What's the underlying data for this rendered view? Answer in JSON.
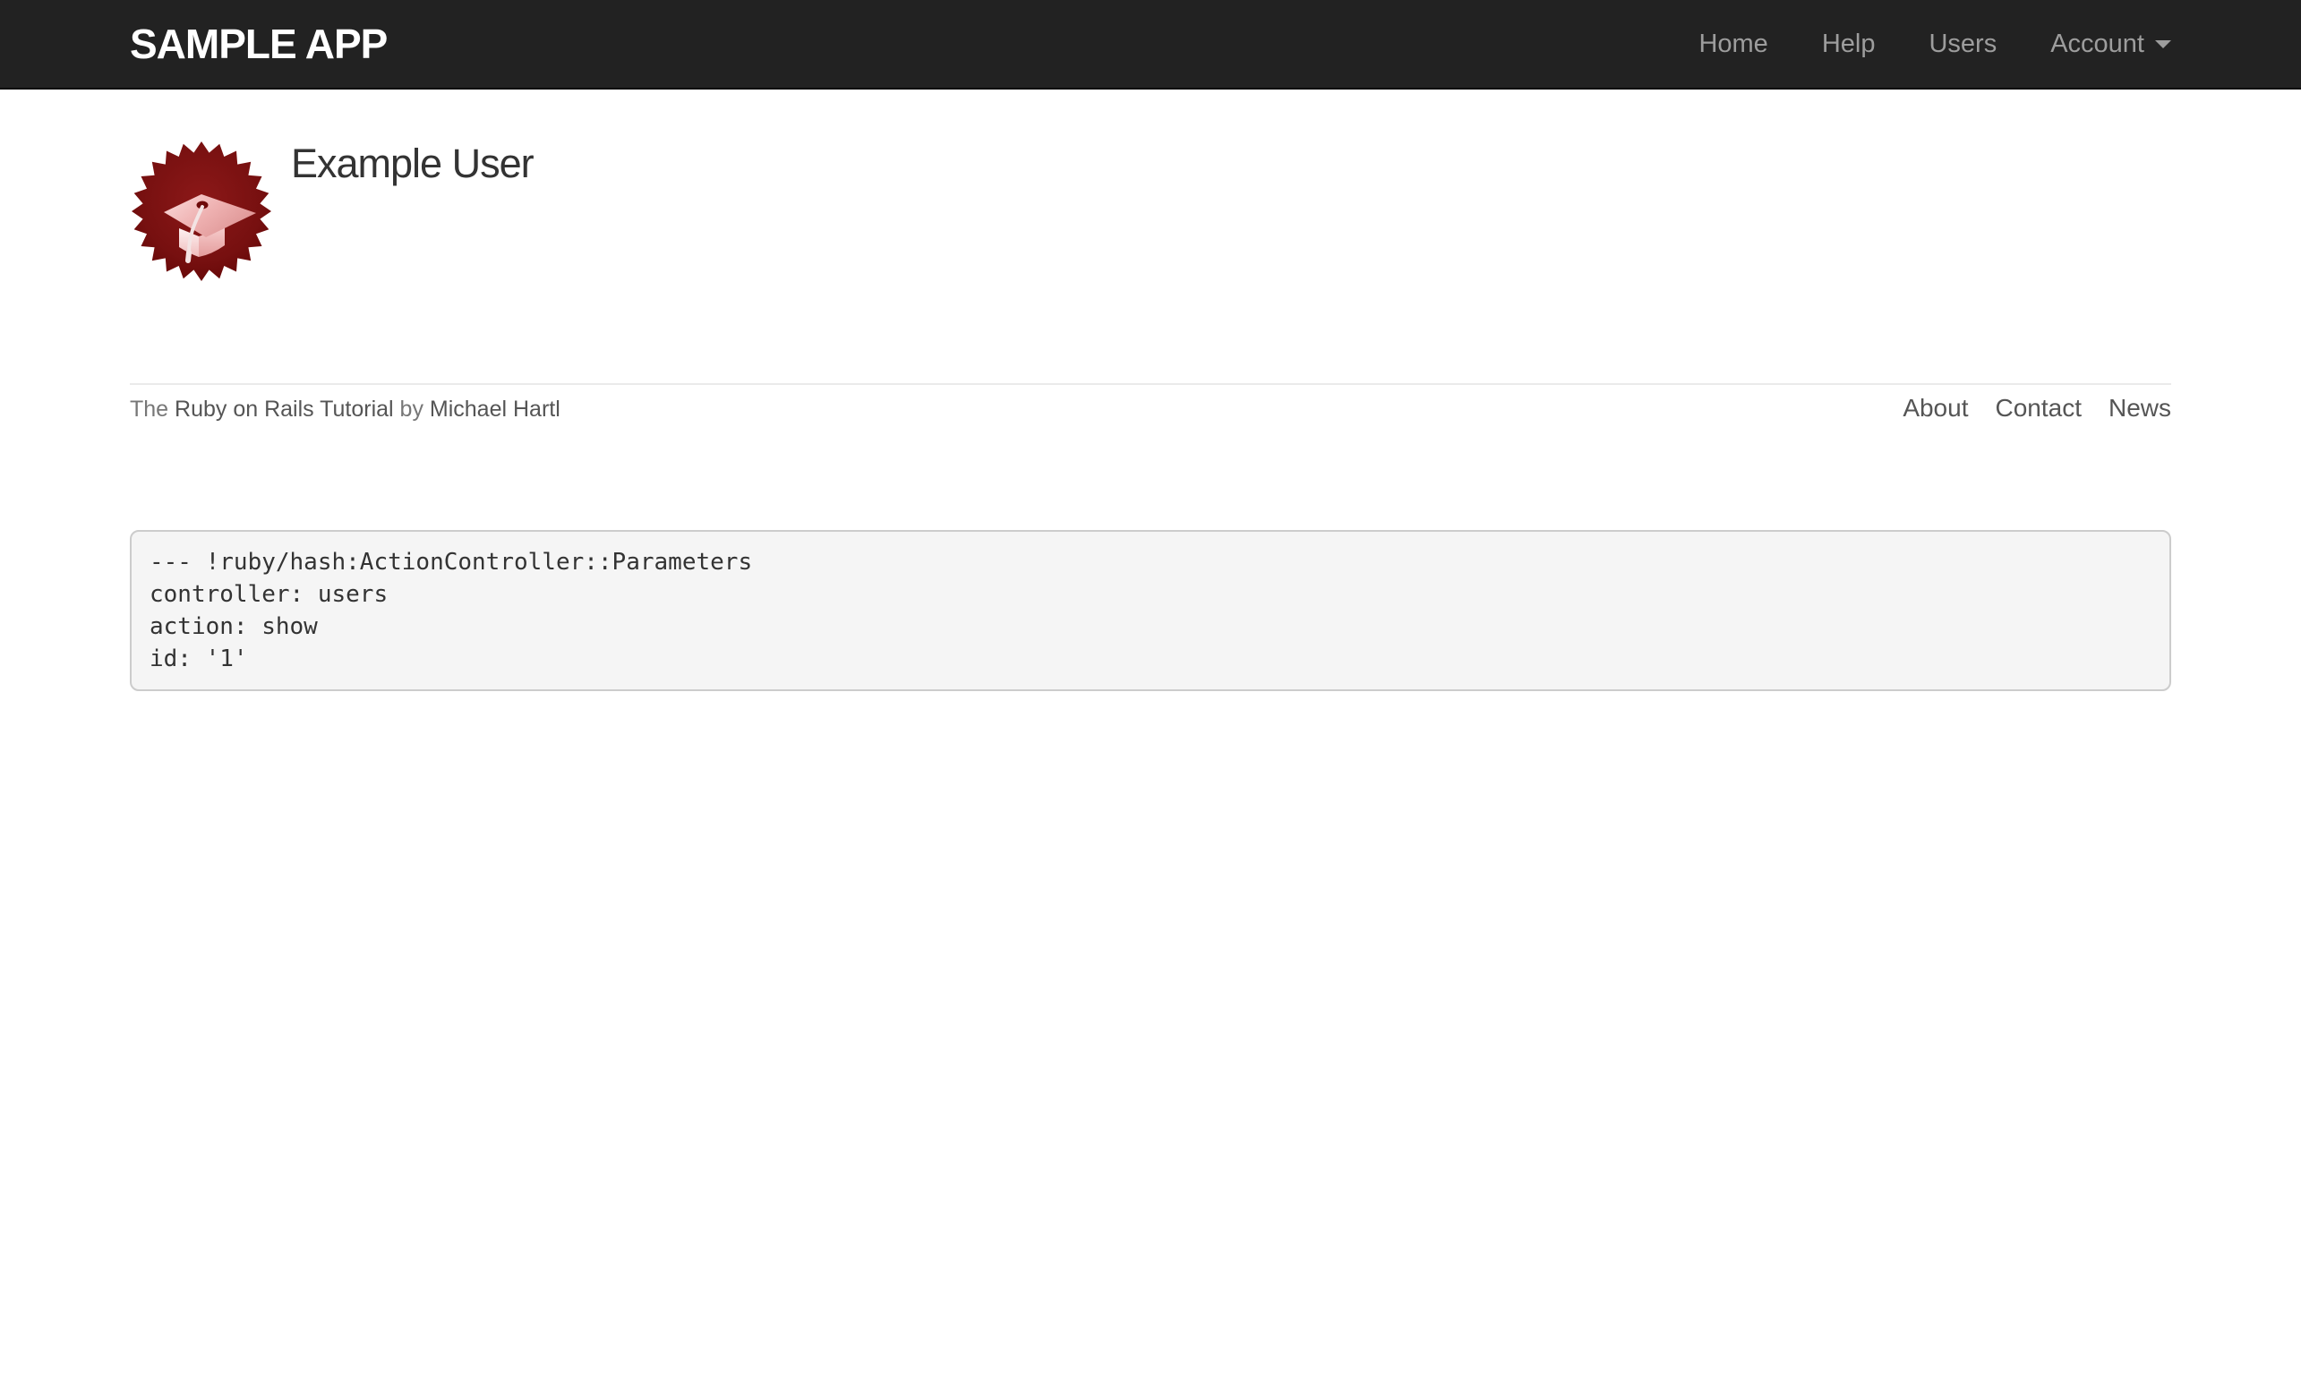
{
  "navbar": {
    "brand": "SAMPLE APP",
    "links": [
      {
        "label": "Home"
      },
      {
        "label": "Help"
      },
      {
        "label": "Users"
      },
      {
        "label": "Account",
        "has_dropdown": true
      }
    ]
  },
  "profile": {
    "user_name": "Example User",
    "avatar_description": "dark-red starburst seal with graduation cap"
  },
  "footer": {
    "attribution": {
      "prefix": "The ",
      "tutorial_link": "Ruby on Rails Tutorial",
      "middle": " by ",
      "author_link": "Michael Hartl"
    },
    "links": [
      {
        "label": "About"
      },
      {
        "label": "Contact"
      },
      {
        "label": "News"
      }
    ]
  },
  "debug": {
    "text": "--- !ruby/hash:ActionController::Parameters\ncontroller: users\naction: show\nid: '1'"
  },
  "colors": {
    "navbar_bg": "#222222",
    "navbar_border": "#080808",
    "navbar_link": "#9d9d9d",
    "brand_text": "#ffffff",
    "heading_text": "#333333",
    "footer_muted_text": "#777777",
    "footer_link": "#555555",
    "footer_border": "#eaeaea",
    "debug_bg": "#f5f5f5",
    "debug_border": "#cccccc",
    "debug_text": "#333333",
    "avatar_red_center": "#8c1818",
    "avatar_red_edge": "#650707",
    "avatar_cap_pink": "#e8a7a7",
    "avatar_cap_light": "#fdf2f2"
  }
}
